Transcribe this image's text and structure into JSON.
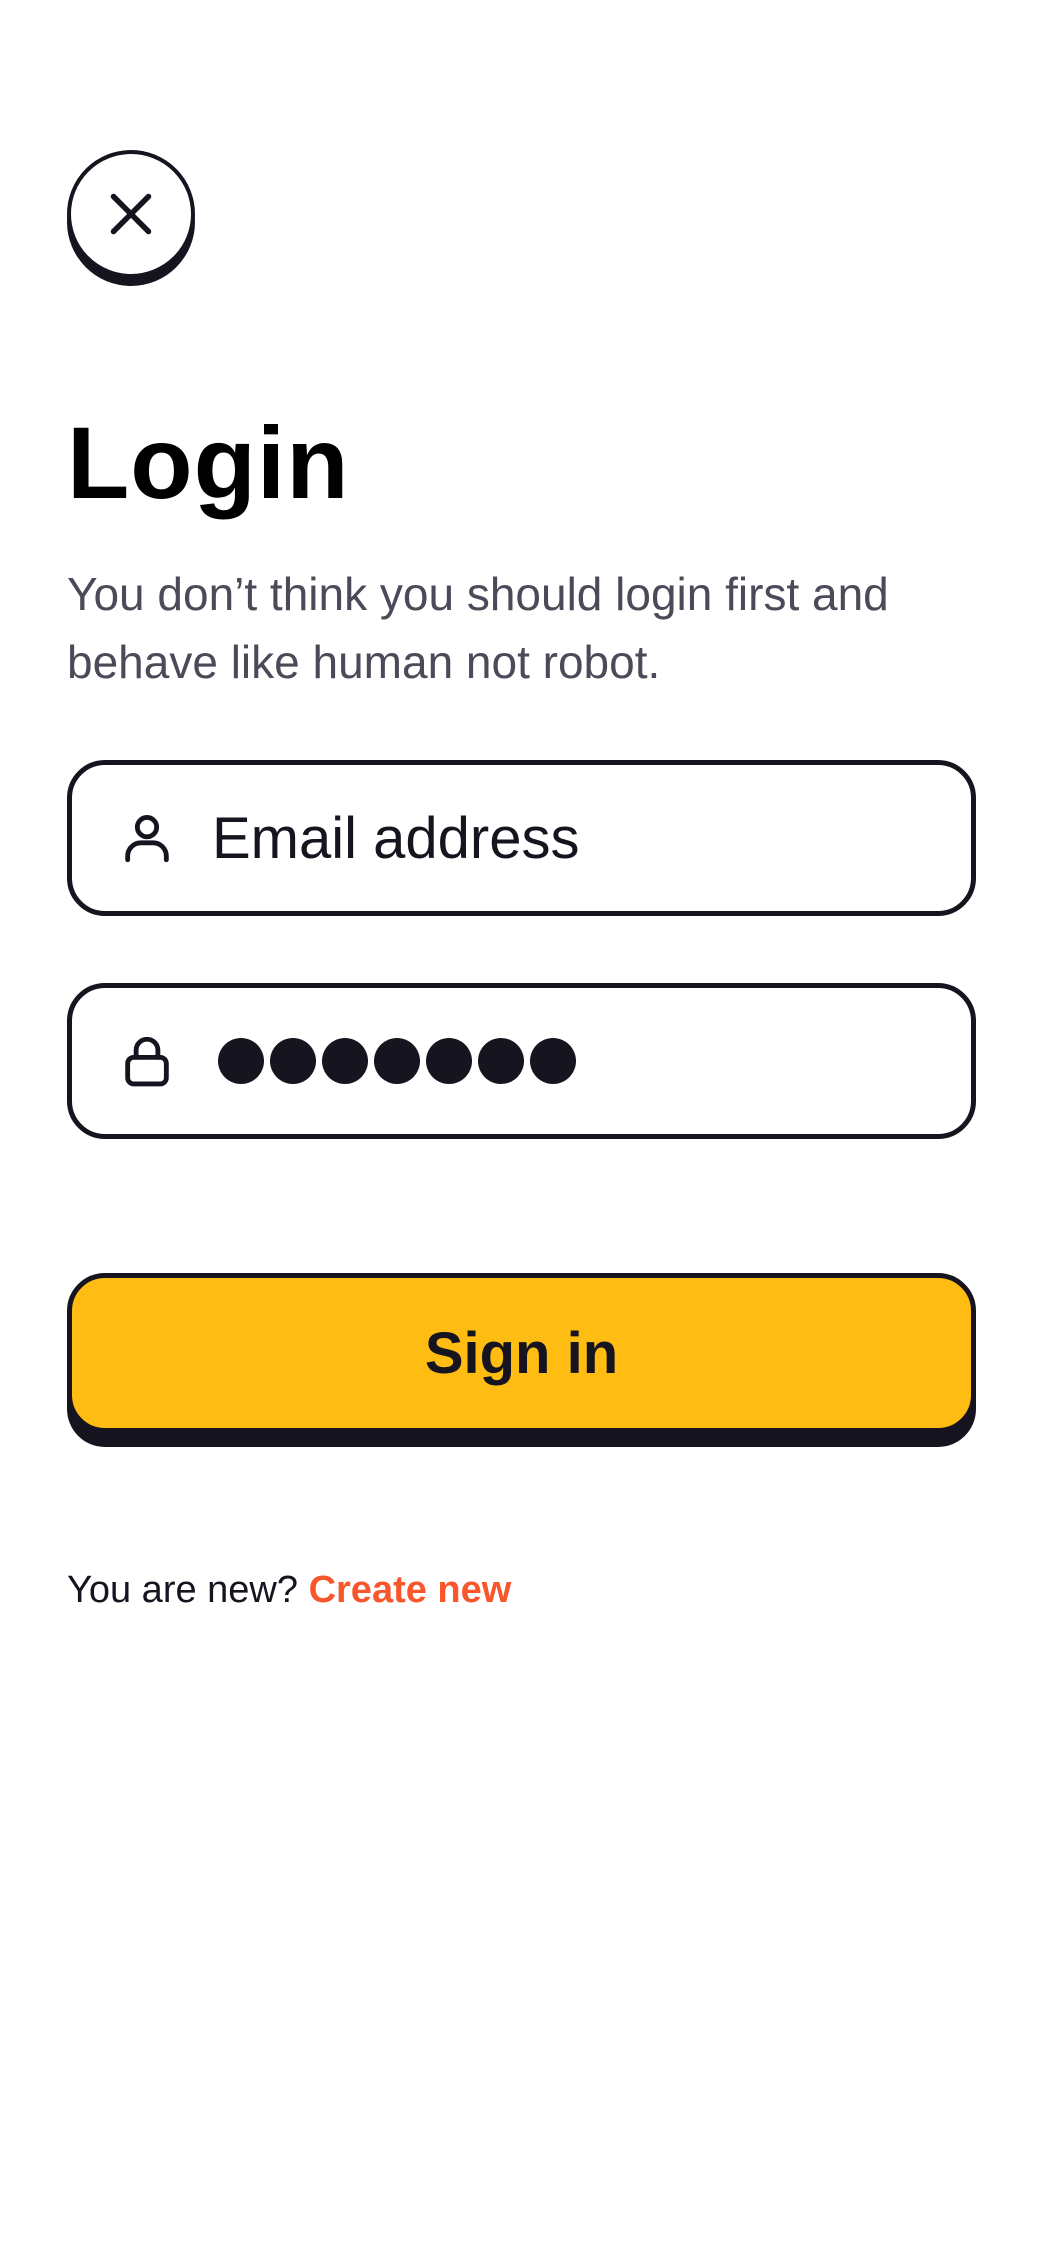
{
  "header": {
    "close_icon": "close-icon"
  },
  "login": {
    "title": "Login",
    "subtitle": "You don’t think you should login first and behave like human not robot."
  },
  "email_field": {
    "icon": "user-icon",
    "placeholder": "Email address",
    "value": ""
  },
  "password_field": {
    "icon": "lock-icon",
    "masked_length": 7
  },
  "signin_button": {
    "label": "Sign in",
    "color": "#ffbc12"
  },
  "signup": {
    "prompt": "You are new?",
    "link_label": "Create new",
    "link_color": "#f7572a"
  }
}
